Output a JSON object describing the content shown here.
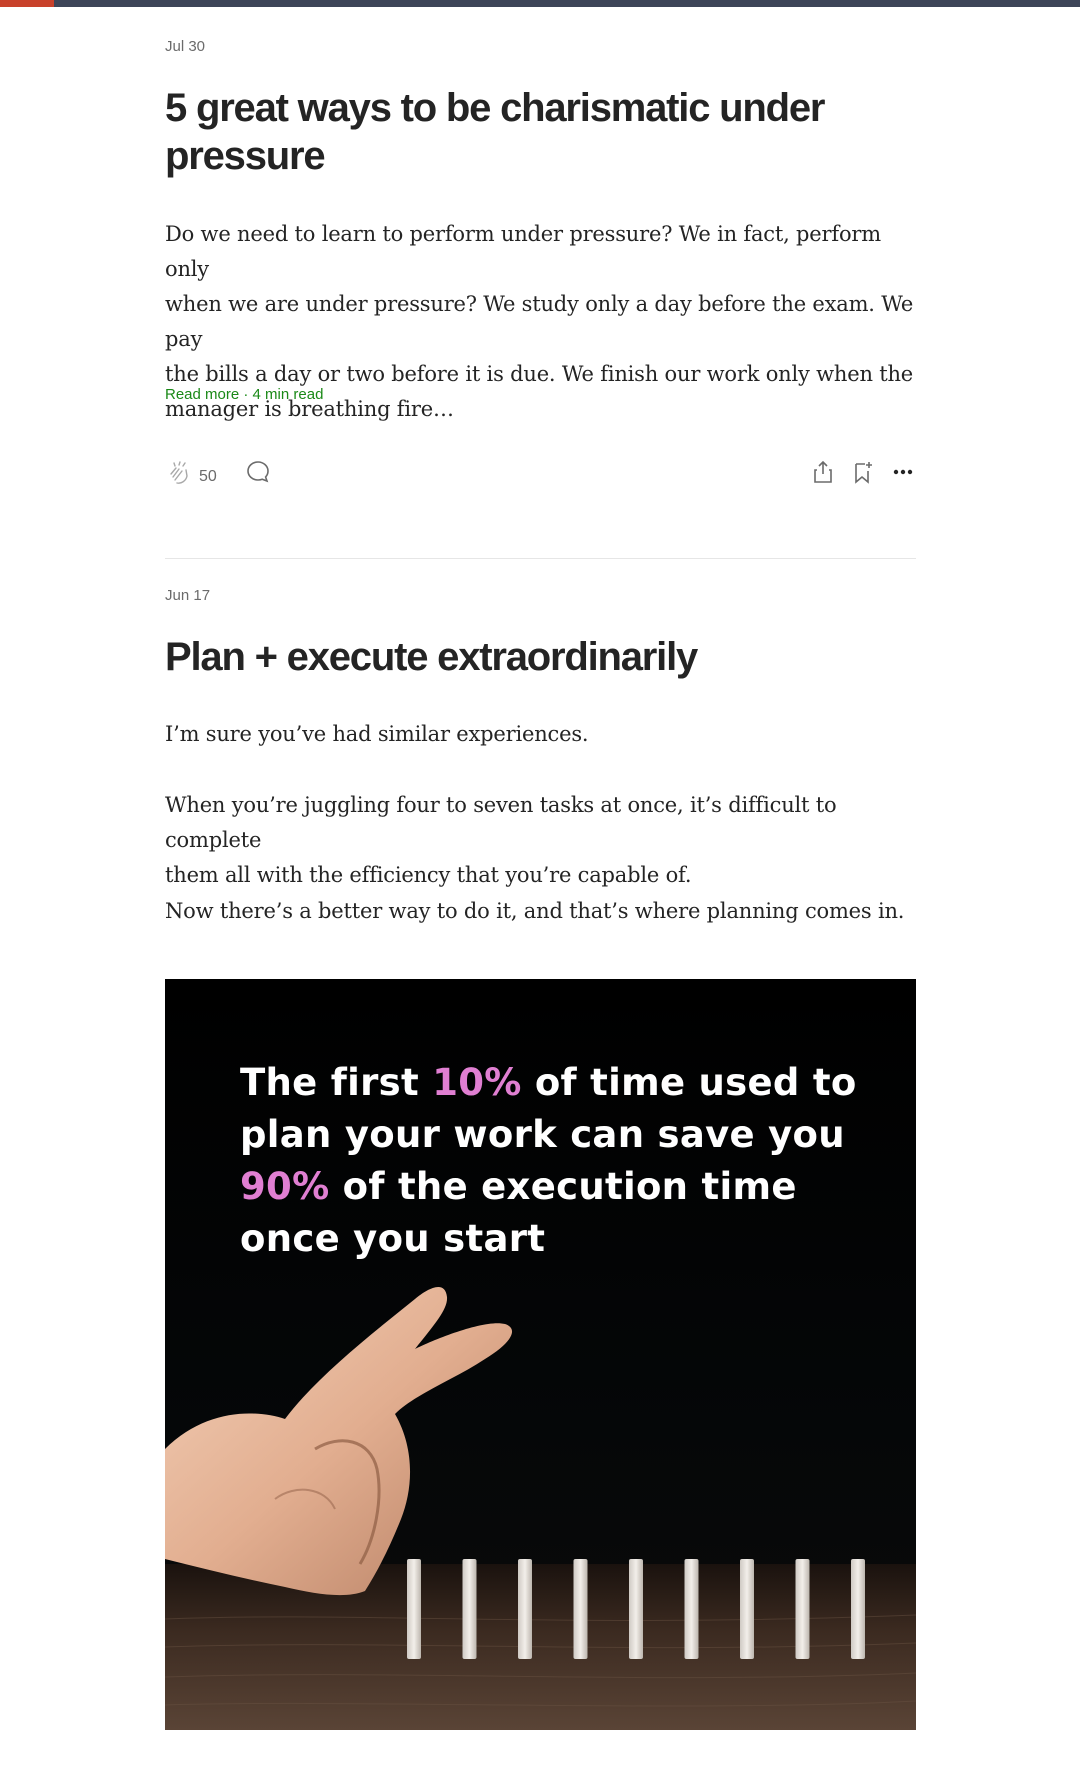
{
  "reading_progress": 0.05,
  "colors": {
    "accent_green": "#1a8917",
    "progress_red": "#c8412b",
    "highlight_pink": "#e07fd2"
  },
  "post1": {
    "date": "Jul 30",
    "title_line1": "5 great ways to be charismatic under",
    "title_line2": "pressure",
    "excerpt_line1": "Do we need to learn to perform under pressure? We in fact, perform only",
    "excerpt_line2": "when we are under pressure? We study only a day before the exam. We pay",
    "excerpt_line3": "the bills a day or two before it is due. We finish our work only when the",
    "excerpt_line4": "manager is breathing fire…",
    "read_more": "Read more",
    "separator": " · ",
    "read_time": "4 min read",
    "clap_count": "50",
    "icons": [
      "clap-icon",
      "response-icon",
      "share-icon",
      "bookmark-icon",
      "more-icon"
    ]
  },
  "post2": {
    "date": "Jun 17",
    "title": "Plan + execute extraordinarily",
    "para1": "I’m sure you’ve had similar experiences.",
    "para2_line1": "When you’re juggling four to seven tasks at once, it’s difficult to complete",
    "para2_line2": "them all with the efficiency that you’re capable of.",
    "para3": "Now there’s a better way to do it, and that’s where planning comes in.",
    "image_quote": {
      "part1": "The first ",
      "hl1": "10%",
      "part2": " of time used to plan your work can save you ",
      "hl2": "90%",
      "part3": " of the execution time once you start"
    }
  }
}
